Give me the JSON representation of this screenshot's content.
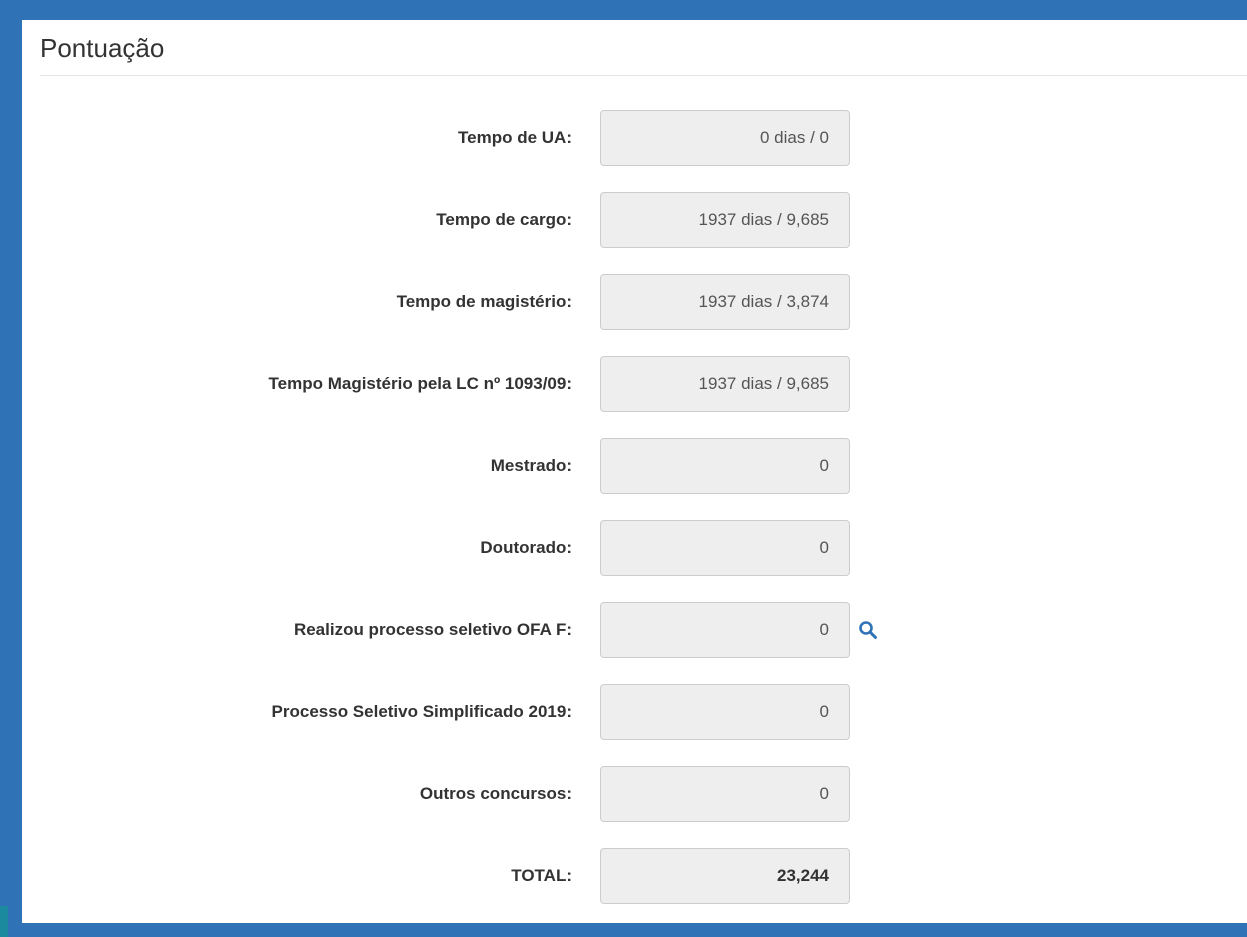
{
  "section": {
    "title": "Pontuação"
  },
  "fields": [
    {
      "label": "Tempo de UA:",
      "value": "0 dias / 0"
    },
    {
      "label": "Tempo de cargo:",
      "value": "1937 dias / 9,685"
    },
    {
      "label": "Tempo de magistério:",
      "value": "1937 dias / 3,874"
    },
    {
      "label": "Tempo Magistério pela LC nº 1093/09:",
      "value": "1937 dias / 9,685"
    },
    {
      "label": "Mestrado:",
      "value": "0"
    },
    {
      "label": "Doutorado:",
      "value": "0"
    },
    {
      "label": "Realizou processo seletivo OFA F:",
      "value": "0",
      "action_icon": "search-icon"
    },
    {
      "label": "Processo Seletivo Simplificado 2019:",
      "value": "0"
    },
    {
      "label": "Outros concursos:",
      "value": "0"
    },
    {
      "label": "TOTAL:",
      "value": "23,244"
    }
  ],
  "colors": {
    "frame_blue": "#2f73b6",
    "icon_blue": "#2f73b6",
    "field_bg": "#eeeeee",
    "field_border": "#cccccc"
  }
}
